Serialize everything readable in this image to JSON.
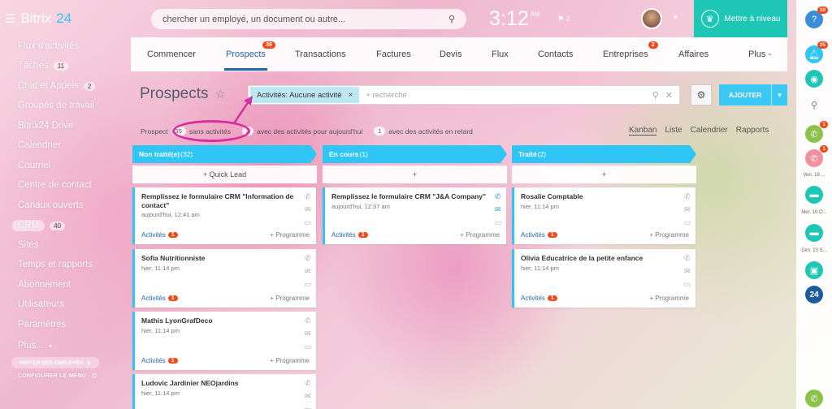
{
  "app": {
    "name": "Bitrix",
    "version": "24",
    "menu_icon": "burger-icon"
  },
  "search": {
    "placeholder": "chercher un employé, un document ou autre..."
  },
  "clock": {
    "time": "3:12",
    "ampm": "AM"
  },
  "pins": {
    "icon": "pin-icon",
    "count": "2"
  },
  "upgrade": {
    "label": "Mettre à niveau",
    "icon": "crown-icon"
  },
  "sidebar": {
    "items": [
      {
        "label": "Flux d'activités"
      },
      {
        "label": "Tâches",
        "count": "11"
      },
      {
        "label": "Chat et Appels",
        "count": "2"
      },
      {
        "label": "Groupes de travail"
      },
      {
        "label": "Bitrix24.Drive"
      },
      {
        "label": "Calendrier"
      },
      {
        "label": "Courriel"
      },
      {
        "label": "Centre de contact"
      },
      {
        "label": "Canaux ouverts"
      },
      {
        "label": "CRM",
        "count": "40"
      },
      {
        "label": "Sites"
      },
      {
        "label": "Temps et rapports"
      },
      {
        "label": "Abonnement"
      },
      {
        "label": "Utilisateurs"
      },
      {
        "label": "Paramètres"
      },
      {
        "label": "Plus..."
      }
    ],
    "configure": "CONFIGURER LE MENU",
    "invite": "INVITER DES EMPLOYÉS"
  },
  "tabs": [
    {
      "label": "Commencer"
    },
    {
      "label": "Prospects",
      "badge": "38"
    },
    {
      "label": "Transactions"
    },
    {
      "label": "Factures"
    },
    {
      "label": "Devis"
    },
    {
      "label": "Flux"
    },
    {
      "label": "Contacts"
    },
    {
      "label": "Entreprises",
      "badge": "2"
    },
    {
      "label": "Affaires"
    },
    {
      "label": "Plus -"
    }
  ],
  "page": {
    "title": "Prospects"
  },
  "filter": {
    "chip": "Activités: Aucune activité",
    "placeholder": "+ recherche"
  },
  "add_button": {
    "label": "AJOUTER"
  },
  "stats": {
    "prefix": "Prospect",
    "no_activity_count": "35",
    "no_activity_label": "sans activités",
    "today_count": "2",
    "today_label": "avec des activités pour aujourd'hui",
    "late_count": "1",
    "late_label": "avec des activités en retard"
  },
  "views": [
    "Kanban",
    "Liste",
    "Calendrier",
    "Rapports"
  ],
  "columns": [
    {
      "title": "Non traité(e)",
      "count": "(32)",
      "add_label": "+ Quick Lead",
      "cards": [
        {
          "title": "Remplissez le formulaire CRM \"Information de contact\"",
          "date": "aujourd'hui, 12:41 am",
          "activities": "Activités",
          "badge": "1",
          "program": "+ Programme"
        },
        {
          "title": "Sofia Nutritionniste",
          "date": "hier, 11:14 pm",
          "activities": "Activités",
          "badge": "1",
          "program": "+ Programme"
        },
        {
          "title": "Mathis LyonGrafDeco",
          "date": "hier, 11:14 pm",
          "activities": "Activités",
          "badge": "1",
          "program": "+ Programme"
        },
        {
          "title": "Ludovic Jardinier NEOjardins",
          "date": "hier, 11:14 pm",
          "activities": "",
          "badge": "",
          "program": ""
        }
      ]
    },
    {
      "title": "En cours",
      "count": "(1)",
      "add_label": "+",
      "cards": [
        {
          "title": "Remplissez le formulaire CRM \"J&A Company\"",
          "date": "aujourd'hui, 12:37 am",
          "activities": "Activités",
          "badge": "1",
          "program": "+ Programme"
        }
      ]
    },
    {
      "title": "Traité",
      "count": "(2)",
      "add_label": "+",
      "cards": [
        {
          "title": "Rosalie Comptable",
          "date": "hier, 11:14 pm",
          "activities": "Activités",
          "badge": "1",
          "program": "+ Programme"
        },
        {
          "title": "Olivia Educatrice de la petite enfance",
          "date": "hier, 11:14 pm",
          "activities": "Activités",
          "badge": "1",
          "program": "+ Programme"
        }
      ]
    }
  ],
  "rightbar": {
    "help_badge": "10",
    "notif_badge": "25",
    "call1_badge": "1",
    "call2_badge": "1",
    "dates": [
      "Ven. 19 ...",
      "Mer. 10 O...",
      "Dim. 23 S..."
    ],
    "b24_label": "24"
  }
}
